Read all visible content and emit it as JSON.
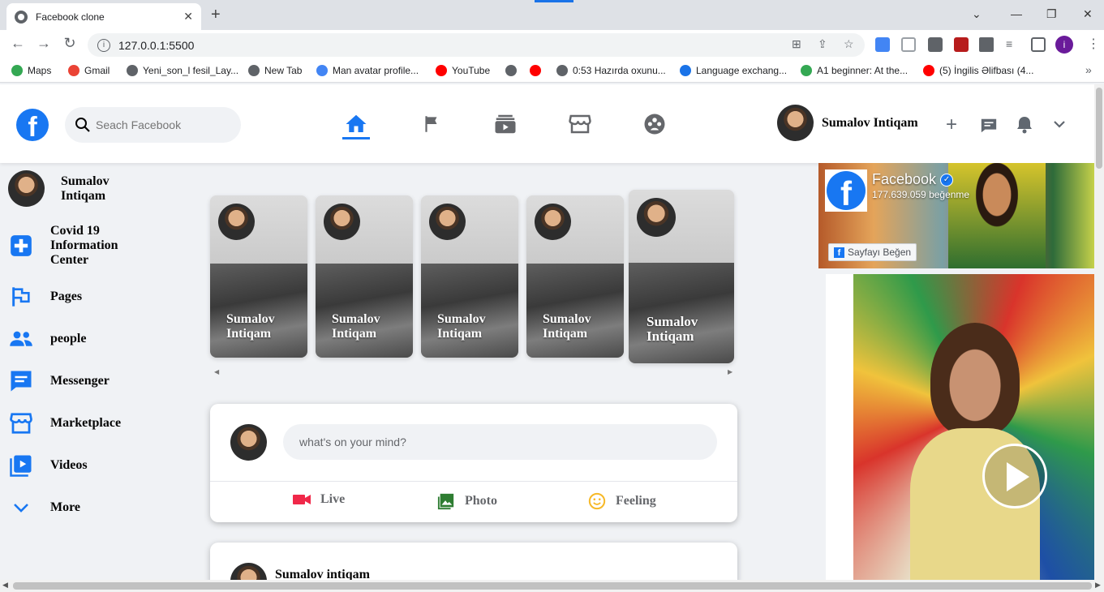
{
  "browser": {
    "tab_title": "Facebook clone",
    "tab_close": "✕",
    "new_tab": "+",
    "url": "127.0.0.1:5500",
    "bookmarks": [
      {
        "label": "Maps",
        "color": "#34a853"
      },
      {
        "label": "Gmail",
        "color": "#ea4335"
      },
      {
        "label": "Yeni_son_l fesil_Lay...",
        "color": "#5f6368"
      },
      {
        "label": "New Tab",
        "color": "#5f6368"
      },
      {
        "label": "Man avatar profile...",
        "color": "#4285f4"
      },
      {
        "label": "YouTube",
        "color": "#ff0000"
      },
      {
        "label": "",
        "color": "#5f6368"
      },
      {
        "label": "",
        "color": "#ff0000"
      },
      {
        "label": "0:53 Hazırda oxunu...",
        "color": "#5f6368"
      },
      {
        "label": "Language exchang...",
        "color": "#1a73e8"
      },
      {
        "label": "A1 beginner: At the...",
        "color": "#34a853"
      },
      {
        "label": "(5) İngilis Əlifbası (4...",
        "color": "#ff0000"
      }
    ],
    "more_bookmarks": "»",
    "profile_initial": "i"
  },
  "header": {
    "search_placeholder": "Seach Facebook",
    "user_name": "Sumalov Intiqam",
    "accent_color": "#1877f2"
  },
  "sidebar": {
    "profile_name": "Sumalov Intiqam",
    "items": [
      {
        "label": "Covid 19 Information Center",
        "icon": "plus-square-icon"
      },
      {
        "label": "Pages",
        "icon": "flag-icon"
      },
      {
        "label": "people",
        "icon": "people-icon"
      },
      {
        "label": "Messenger",
        "icon": "messenger-icon"
      },
      {
        "label": "Marketplace",
        "icon": "store-icon"
      },
      {
        "label": "Videos",
        "icon": "video-icon"
      },
      {
        "label": "More",
        "icon": "chevron-down-icon"
      }
    ]
  },
  "stories": [
    {
      "name": "Sumalov Intiqam"
    },
    {
      "name": "Sumalov Intiqam"
    },
    {
      "name": "Sumalov Intiqam"
    },
    {
      "name": "Sumalov Intiqam"
    },
    {
      "name": "Sumalov Intiqam"
    }
  ],
  "composer": {
    "placeholder": "what's on your mind?",
    "actions": [
      {
        "label": "Live",
        "color": "#f02849"
      },
      {
        "label": "Photo",
        "color": "#45bd62"
      },
      {
        "label": "Feeling",
        "color": "#f7b928"
      }
    ]
  },
  "post": {
    "author": "Sumalov intiqam"
  },
  "fb_page_widget": {
    "name": "Facebook",
    "likes": "177.639.059 beğenme",
    "like_button": "Sayfayı Beğen"
  }
}
